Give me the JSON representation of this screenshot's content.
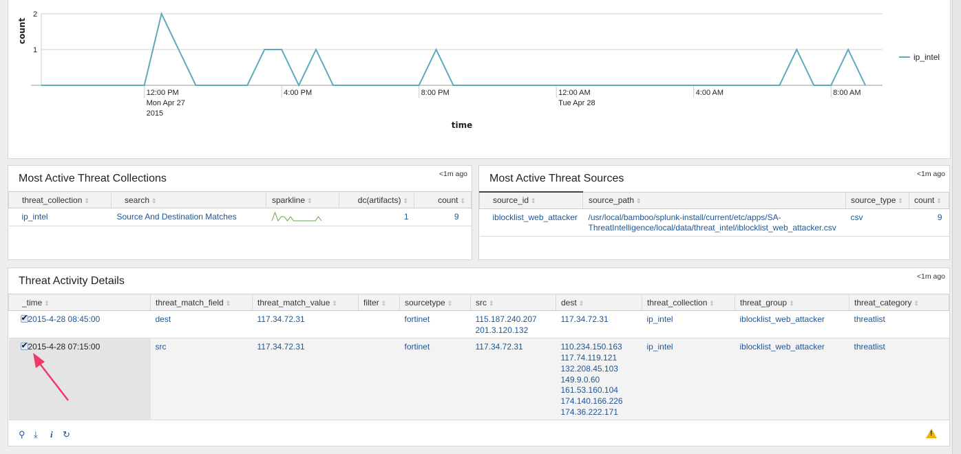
{
  "chart_data": {
    "type": "line",
    "xlabel": "time",
    "ylabel": "count",
    "y_ticks": [
      "1",
      "2"
    ],
    "ylim": [
      0,
      2
    ],
    "xlim": [
      "2015-04-27 09:00",
      "2015-04-28 09:30"
    ],
    "grid": true,
    "legend_placement": "right",
    "x_ticks": [
      {
        "time": "2015-04-27 12:00",
        "label": [
          "12:00 PM",
          "Mon Apr 27",
          "2015"
        ]
      },
      {
        "time": "2015-04-27 16:00",
        "label": [
          "4:00 PM"
        ]
      },
      {
        "time": "2015-04-27 20:00",
        "label": [
          "8:00 PM"
        ]
      },
      {
        "time": "2015-04-28 00:00",
        "label": [
          "12:00 AM",
          "Tue Apr 28"
        ]
      },
      {
        "time": "2015-04-28 04:00",
        "label": [
          "4:00 AM"
        ]
      },
      {
        "time": "2015-04-28 08:00",
        "label": [
          "8:00 AM"
        ]
      }
    ],
    "series": [
      {
        "name": "ip_intel",
        "color": "#5aa9bd",
        "x": [
          "2015-04-27 09:00",
          "2015-04-27 09:30",
          "2015-04-27 10:00",
          "2015-04-27 10:30",
          "2015-04-27 11:00",
          "2015-04-27 11:30",
          "2015-04-27 12:00",
          "2015-04-27 12:30",
          "2015-04-27 13:00",
          "2015-04-27 13:30",
          "2015-04-27 14:00",
          "2015-04-27 14:30",
          "2015-04-27 15:00",
          "2015-04-27 15:30",
          "2015-04-27 16:00",
          "2015-04-27 16:30",
          "2015-04-27 17:00",
          "2015-04-27 17:30",
          "2015-04-27 18:00",
          "2015-04-27 18:30",
          "2015-04-27 19:00",
          "2015-04-27 19:30",
          "2015-04-27 20:00",
          "2015-04-27 20:30",
          "2015-04-27 21:00",
          "2015-04-27 21:30",
          "2015-04-27 22:00",
          "2015-04-27 22:30",
          "2015-04-27 23:00",
          "2015-04-27 23:30",
          "2015-04-28 00:00",
          "2015-04-28 00:30",
          "2015-04-28 01:00",
          "2015-04-28 01:30",
          "2015-04-28 02:00",
          "2015-04-28 02:30",
          "2015-04-28 03:00",
          "2015-04-28 03:30",
          "2015-04-28 04:00",
          "2015-04-28 04:30",
          "2015-04-28 05:00",
          "2015-04-28 05:30",
          "2015-04-28 06:00",
          "2015-04-28 06:30",
          "2015-04-28 07:00",
          "2015-04-28 07:30",
          "2015-04-28 08:00",
          "2015-04-28 08:30",
          "2015-04-28 09:00"
        ],
        "values": [
          0,
          0,
          0,
          0,
          0,
          0,
          0,
          2,
          1,
          0,
          0,
          0,
          0,
          1,
          1,
          0,
          1,
          0,
          0,
          0,
          0,
          0,
          0,
          1,
          0,
          0,
          0,
          0,
          0,
          0,
          0,
          0,
          0,
          0,
          0,
          0,
          0,
          0,
          0,
          0,
          0,
          0,
          0,
          0,
          1,
          0,
          0,
          1,
          0
        ]
      }
    ]
  },
  "collections": {
    "title": "Most Active Threat Collections",
    "updated": "<1m ago",
    "columns": [
      "threat_collection",
      "search",
      "sparkline",
      "dc(artifacts)",
      "count"
    ],
    "rows": [
      {
        "threat_collection": "ip_intel",
        "search": "Source And Destination Matches",
        "sparkline": [
          0,
          2,
          0,
          1,
          1,
          0,
          1,
          0,
          0,
          0,
          0,
          0,
          0,
          0,
          0,
          1,
          0
        ],
        "dc_artifacts": "1",
        "count": "9"
      }
    ],
    "sparkline_color": "#65a637"
  },
  "sources": {
    "title": "Most Active Threat Sources",
    "updated": "<1m ago",
    "columns": [
      "source_id",
      "source_path",
      "source_type",
      "count"
    ],
    "rows": [
      {
        "source_id": "iblocklist_web_attacker",
        "source_path": [
          "/usr/local/bamboo/splunk-install/current/etc/apps/SA-",
          "ThreatIntelligence/local/data/threat_intel/iblocklist_web_attacker.csv"
        ],
        "source_type": "csv",
        "count": "9"
      }
    ]
  },
  "activity": {
    "title": "Threat Activity Details",
    "updated": "<1m ago",
    "columns": [
      "_time",
      "threat_match_field",
      "threat_match_value",
      "filter",
      "sourcetype",
      "src",
      "dest",
      "threat_collection",
      "threat_group",
      "threat_category"
    ],
    "rows": [
      {
        "time": "2015-4-28 08:45:00",
        "threat_match_field": "dest",
        "threat_match_value": "117.34.72.31",
        "filter": "",
        "sourcetype": "fortinet",
        "src": [
          "115.187.240.207",
          "201.3.120.132"
        ],
        "dest": [
          "117.34.72.31"
        ],
        "threat_collection": "ip_intel",
        "threat_group": "iblocklist_web_attacker",
        "threat_category": "threatlist",
        "checked": true
      },
      {
        "time": "2015-4-28 07:15:00",
        "threat_match_field": "src",
        "threat_match_value": "117.34.72.31",
        "filter": "",
        "sourcetype": "fortinet",
        "src": [
          "117.34.72.31"
        ],
        "dest": [
          "110.234.150.163",
          "117.74.119.121",
          "132.208.45.103",
          "149.9.0.60",
          "161.53.160.104",
          "174.140.166.226",
          "174.36.222.171"
        ],
        "threat_collection": "ip_intel",
        "threat_group": "iblocklist_web_attacker",
        "threat_category": "threatlist",
        "checked": true
      }
    ],
    "footer_icons": [
      "search-icon",
      "download-icon",
      "info-icon",
      "refresh-icon",
      "warning-icon"
    ]
  },
  "annotation": {
    "type": "arrow",
    "color": "#f0386b"
  }
}
